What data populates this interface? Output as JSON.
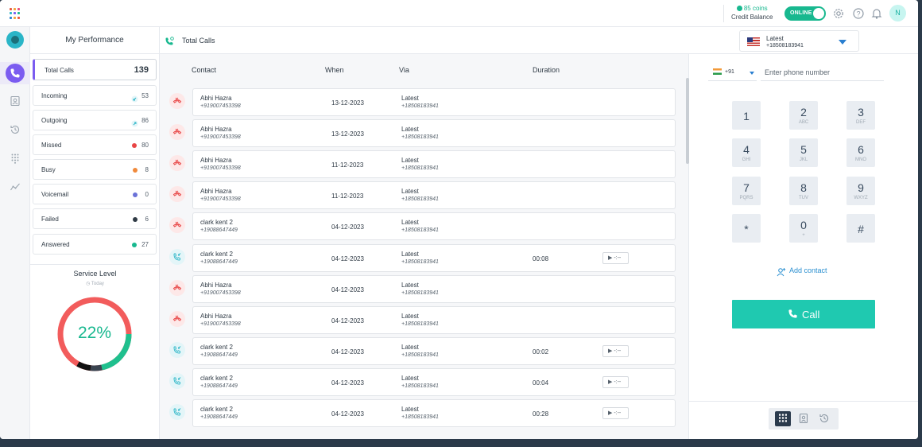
{
  "topbar": {
    "coins_label": "85 coins",
    "credit_label": "Credit Balance",
    "status_label": "ONLINE",
    "avatar_initial": "N"
  },
  "performance": {
    "title": "My Performance",
    "stats": [
      {
        "label": "Total Calls",
        "count": "139",
        "marker": "none"
      },
      {
        "label": "Incoming",
        "count": "53",
        "marker": "incoming-icon",
        "color": "#2ab5c7"
      },
      {
        "label": "Outgoing",
        "count": "86",
        "marker": "outgoing-icon",
        "color": "#2ab5c7"
      },
      {
        "label": "Missed",
        "count": "80",
        "marker": "dot",
        "color": "#e84545"
      },
      {
        "label": "Busy",
        "count": "8",
        "marker": "dot",
        "color": "#f08a3c"
      },
      {
        "label": "Voicemail",
        "count": "0",
        "marker": "dot",
        "color": "#6b72d8"
      },
      {
        "label": "Failed",
        "count": "6",
        "marker": "dot",
        "color": "#2f3a45"
      },
      {
        "label": "Answered",
        "count": "27",
        "marker": "dot",
        "color": "#18b88f"
      }
    ],
    "service_level": {
      "title": "Service Level",
      "period": "Today",
      "value": "22%",
      "fraction": 0.22
    }
  },
  "calls": {
    "title": "Total Calls",
    "columns": [
      "Contact",
      "When",
      "Via",
      "Duration"
    ],
    "rows": [
      {
        "type": "missed",
        "name": "Abhi Hazra",
        "number": "+919007453398",
        "when": "13-12-2023",
        "via": "Latest",
        "via_number": "+18508183941",
        "duration": "",
        "play": ""
      },
      {
        "type": "missed",
        "name": "Abhi Hazra",
        "number": "+919007453398",
        "when": "13-12-2023",
        "via": "Latest",
        "via_number": "+18508183941",
        "duration": "",
        "play": ""
      },
      {
        "type": "missed",
        "name": "Abhi Hazra",
        "number": "+919007453398",
        "when": "11-12-2023",
        "via": "Latest",
        "via_number": "+18508183941",
        "duration": "",
        "play": ""
      },
      {
        "type": "missed",
        "name": "Abhi Hazra",
        "number": "+919007453398",
        "when": "11-12-2023",
        "via": "Latest",
        "via_number": "+18508183941",
        "duration": "",
        "play": ""
      },
      {
        "type": "missed",
        "name": "clark kent 2",
        "number": "+19088647449",
        "when": "04-12-2023",
        "via": "Latest",
        "via_number": "+18508183941",
        "duration": "",
        "play": ""
      },
      {
        "type": "incoming",
        "name": "clark kent 2",
        "number": "+19088647449",
        "when": "04-12-2023",
        "via": "Latest",
        "via_number": "+18508183941",
        "duration": "00:08",
        "play": "▶ -:--"
      },
      {
        "type": "missed",
        "name": "Abhi Hazra",
        "number": "+919007453398",
        "when": "04-12-2023",
        "via": "Latest",
        "via_number": "+18508183941",
        "duration": "",
        "play": ""
      },
      {
        "type": "missed",
        "name": "Abhi Hazra",
        "number": "+919007453398",
        "when": "04-12-2023",
        "via": "Latest",
        "via_number": "+18508183941",
        "duration": "",
        "play": ""
      },
      {
        "type": "incoming",
        "name": "clark kent 2",
        "number": "+19088647449",
        "when": "04-12-2023",
        "via": "Latest",
        "via_number": "+18508183941",
        "duration": "00:02",
        "play": "▶ -:--"
      },
      {
        "type": "incoming",
        "name": "clark kent 2",
        "number": "+19088647449",
        "when": "04-12-2023",
        "via": "Latest",
        "via_number": "+18508183941",
        "duration": "00:04",
        "play": "▶ -:--"
      },
      {
        "type": "incoming",
        "name": "clark kent 2",
        "number": "+19088647449",
        "when": "04-12-2023",
        "via": "Latest",
        "via_number": "+18508183941",
        "duration": "00:28",
        "play": "▶ -:--"
      }
    ]
  },
  "dialer": {
    "line_name": "Latest",
    "line_number": "+18508183941",
    "country_code": "+91",
    "phone_placeholder": "Enter phone number",
    "keys": [
      {
        "digit": "1",
        "letters": ""
      },
      {
        "digit": "2",
        "letters": "ABC"
      },
      {
        "digit": "3",
        "letters": "DEF"
      },
      {
        "digit": "4",
        "letters": "GHI"
      },
      {
        "digit": "5",
        "letters": "JKL"
      },
      {
        "digit": "6",
        "letters": "MNO"
      },
      {
        "digit": "7",
        "letters": "PQRS"
      },
      {
        "digit": "8",
        "letters": "TUV"
      },
      {
        "digit": "9",
        "letters": "WXYZ"
      },
      {
        "digit": "*",
        "letters": ""
      },
      {
        "digit": "0",
        "letters": "+"
      },
      {
        "digit": "#",
        "letters": ""
      }
    ],
    "add_contact_label": "Add contact",
    "call_label": "Call"
  },
  "colors": {
    "accent_purple": "#7b5cf0",
    "accent_teal": "#1fc9b0",
    "online_green": "#18b88f",
    "missed_red": "#e84545"
  }
}
